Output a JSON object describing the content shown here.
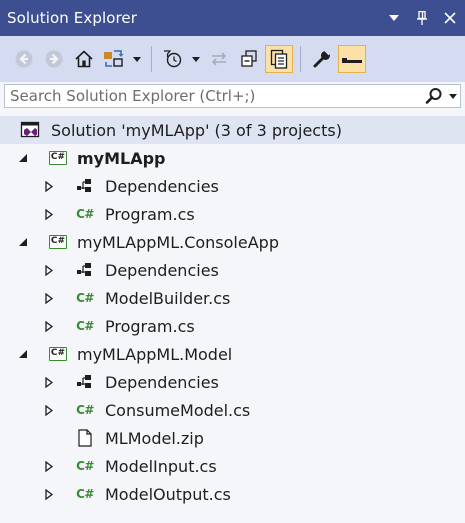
{
  "titlebar": {
    "title": "Solution Explorer",
    "buttons": [
      "chevron-down-icon",
      "pin-icon",
      "close-icon"
    ],
    "bg": "#3d4f91"
  },
  "toolbar": {
    "icons": [
      "back-arrow-icon",
      "forward-arrow-icon",
      "home-icon",
      "switch-views-icon",
      "pending-changes-icon",
      "sync-icon",
      "collapse-all-icon",
      "show-all-files-icon",
      "properties-icon",
      "preview-icon"
    ],
    "bg": "#d5dcf1"
  },
  "search": {
    "placeholder": "Search Solution Explorer (Ctrl+;)"
  },
  "tree": {
    "solution": "Solution 'myMLApp' (3 of 3 projects)",
    "items": [
      {
        "label": "myMLApp",
        "type": "project"
      },
      {
        "label": "Dependencies",
        "type": "dependencies"
      },
      {
        "label": "Program.cs",
        "type": "csfile"
      },
      {
        "label": "myMLAppML.ConsoleApp",
        "type": "project"
      },
      {
        "label": "Dependencies",
        "type": "dependencies"
      },
      {
        "label": "ModelBuilder.cs",
        "type": "csfile"
      },
      {
        "label": "Program.cs",
        "type": "csfile"
      },
      {
        "label": "myMLAppML.Model",
        "type": "project"
      },
      {
        "label": "Dependencies",
        "type": "dependencies"
      },
      {
        "label": "ConsumeModel.cs",
        "type": "csfile"
      },
      {
        "label": "MLModel.zip",
        "type": "file"
      },
      {
        "label": "ModelInput.cs",
        "type": "csfile"
      },
      {
        "label": "ModelOutput.cs",
        "type": "csfile"
      }
    ],
    "project_icon_text": "C#",
    "file_icon_text": "C#",
    "accent": "#388a34"
  }
}
